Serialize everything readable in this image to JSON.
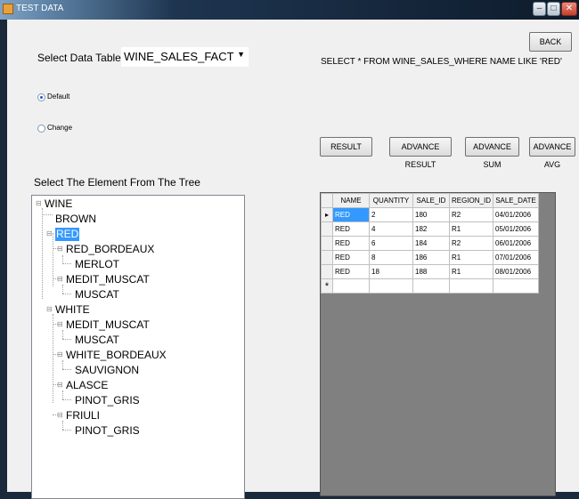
{
  "window": {
    "title": "TEST DATA",
    "min": "–",
    "max": "□",
    "close": "✕"
  },
  "labels": {
    "select_table": "Select Data Table",
    "select_tree": "Select The Element From The Tree",
    "sql": "SELECT * FROM  WINE_SALES_WHERE NAME LIKE 'RED'"
  },
  "combo": {
    "value": "WINE_SALES_FACT"
  },
  "radios": [
    {
      "label": "Default",
      "checked": true
    },
    {
      "label": "Change",
      "checked": false
    }
  ],
  "buttons": {
    "back": "BACK",
    "result": "RESULT",
    "adv_result": "ADVANCE RESULT",
    "adv_sum": "ADVANCE SUM",
    "adv_avg": "ADVANCE AVG"
  },
  "tree": {
    "wine": "WINE",
    "brown": "BROWN",
    "red": "RED",
    "red_bordeaux": "RED_BORDEAUX",
    "merlot": "MERLOT",
    "medit_muscat_1": "MEDIT_MUSCAT",
    "muscat_1": "MUSCAT",
    "white": "WHITE",
    "medit_muscat_2": "MEDIT_MUSCAT",
    "muscat_2": "MUSCAT",
    "white_bordeaux": "WHITE_BORDEAUX",
    "sauvignon": "SAUVIGNON",
    "alasce": "ALASCE",
    "pinot_gris_1": "PINOT_GRIS",
    "friuli": "FRIULI",
    "pinot_gris_2": "PINOT_GRIS"
  },
  "grid": {
    "columns": [
      "NAME",
      "QUANTITY",
      "SALE_ID",
      "REGION_ID",
      "SALE_DATE"
    ],
    "rows": [
      [
        "RED",
        "2",
        "180",
        "R2",
        "04/01/2006"
      ],
      [
        "RED",
        "4",
        "182",
        "R1",
        "05/01/2006"
      ],
      [
        "RED",
        "6",
        "184",
        "R2",
        "06/01/2006"
      ],
      [
        "RED",
        "8",
        "186",
        "R1",
        "07/01/2006"
      ],
      [
        "RED",
        "18",
        "188",
        "R1",
        "08/01/2006"
      ]
    ],
    "current_marker": "▸",
    "new_row_marker": "*"
  }
}
